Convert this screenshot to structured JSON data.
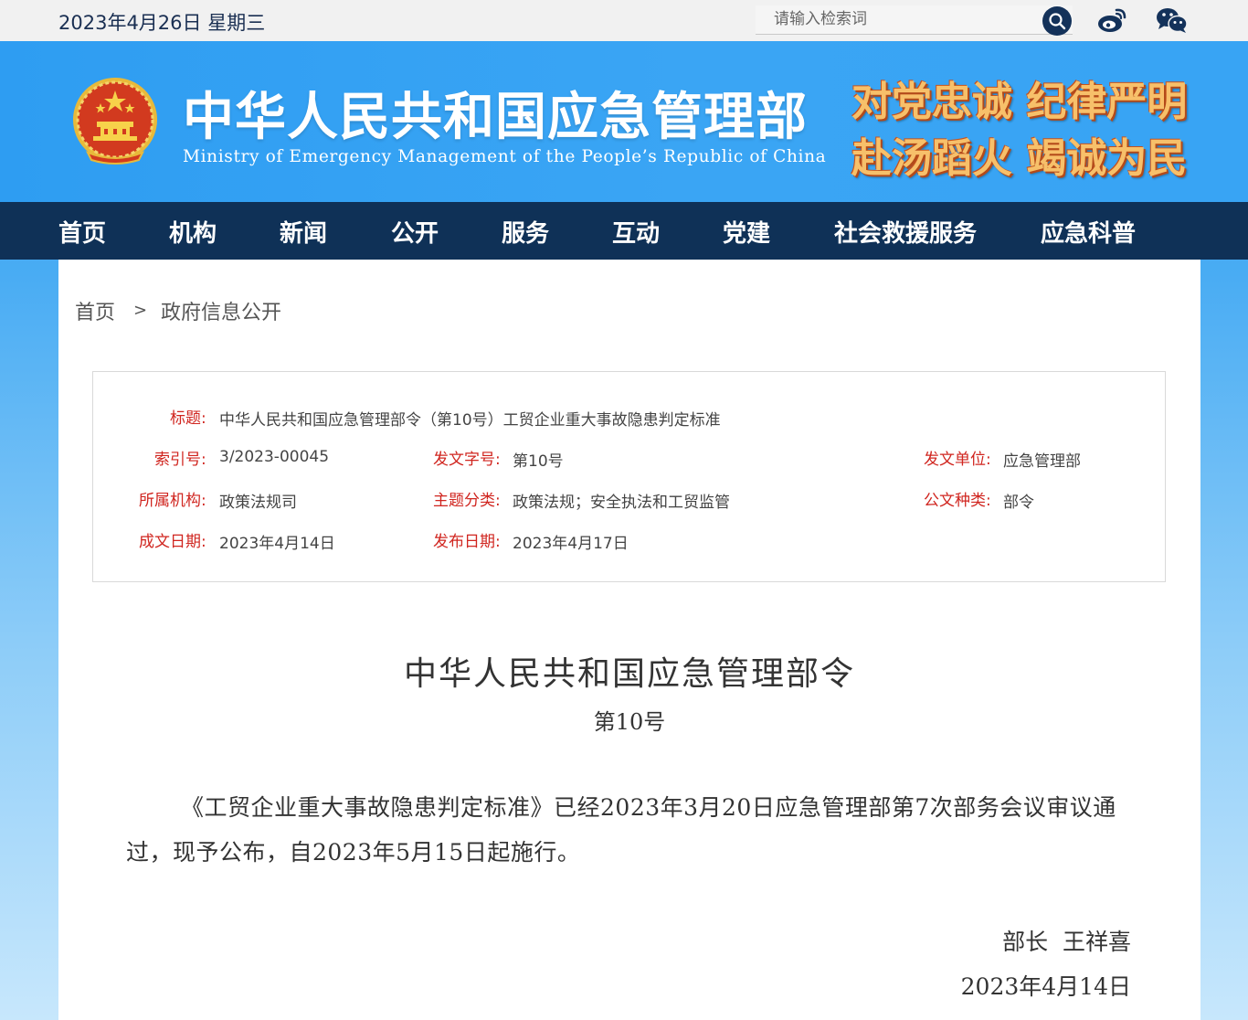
{
  "topbar": {
    "date": "2023年4月26日 星期三",
    "search_placeholder": "请输入检索词"
  },
  "header": {
    "title_cn": "中华人民共和国应急管理部",
    "title_en": "Ministry of Emergency Management of the People’s Republic of China",
    "slogan_line1": "对党忠诚 纪律严明",
    "slogan_line2": "赴汤蹈火 竭诚为民"
  },
  "nav": {
    "items": [
      "首页",
      "机构",
      "新闻",
      "公开",
      "服务",
      "互动",
      "党建",
      "社会救援服务",
      "应急科普"
    ]
  },
  "breadcrumb": {
    "home": "首页",
    "separator": ">",
    "current": "政府信息公开"
  },
  "info": {
    "title_label": "标题:",
    "title_value": "中华人民共和国应急管理部令（第10号）工贸企业重大事故隐患判定标准",
    "index_label": "索引号:",
    "index_value": "3/2023-00045",
    "docno_label": "发文字号:",
    "docno_value": "第10号",
    "issuer_label": "发文单位:",
    "issuer_value": "应急管理部",
    "org_label": "所属机构:",
    "org_value": "政策法规司",
    "topic_label": "主题分类:",
    "topic_value": "政策法规；安全执法和工贸监管",
    "type_label": "公文种类:",
    "type_value": "部令",
    "created_label": "成文日期:",
    "created_value": "2023年4月14日",
    "published_label": "发布日期:",
    "published_value": "2023年4月17日"
  },
  "document": {
    "title": "中华人民共和国应急管理部令",
    "number": "第10号",
    "body": "《工贸企业重大事故隐患判定标准》已经2023年3月20日应急管理部第7次部务会议审议通过，现予公布，自2023年5月15日起施行。",
    "signature": "部长  王祥喜",
    "sign_date": "2023年4月14日"
  },
  "colors": {
    "nav_bg": "#0f3157",
    "label_red": "#d0251f",
    "banner_blue": "#2e9df2"
  }
}
